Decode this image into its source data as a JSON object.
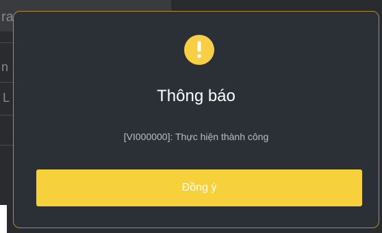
{
  "background": {
    "text_top": "ra",
    "text_mid": "n",
    "text_low": "L"
  },
  "dialog": {
    "icon": "exclamation-icon",
    "title": "Thông báo",
    "message": "[VI000000]: Thực hiện thành công",
    "confirm_label": "Đồng ý"
  },
  "colors": {
    "modal_background": "#2b2f36",
    "modal_border": "#b88a3c",
    "accent": "#f7d13b",
    "icon_background": "#f8ce45"
  }
}
